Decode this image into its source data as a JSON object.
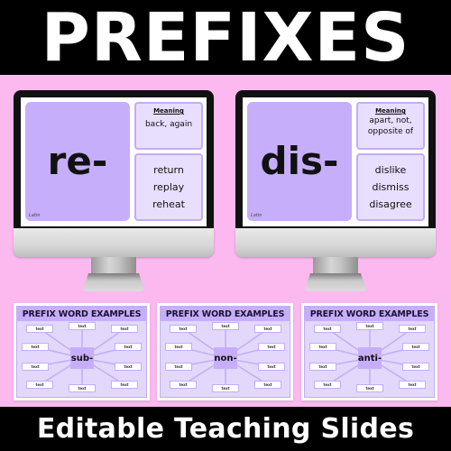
{
  "header": {
    "title": "PREFIXES"
  },
  "footer": {
    "subtitle": "Editable Teaching Slides"
  },
  "colors": {
    "background": "#fbb9ef",
    "banner": "#000000",
    "panel": "#c6aefb",
    "box": "#e8defd",
    "border": "#c3acf7"
  },
  "monitors": [
    {
      "prefix": "re-",
      "origin": "Latin",
      "meaning_label": "Meaning",
      "meaning": "back, again",
      "examples": [
        "return",
        "replay",
        "reheat"
      ]
    },
    {
      "prefix": "dis-",
      "origin": "Latin",
      "meaning_label": "Meaning",
      "meaning": "apart, not, opposite of",
      "examples": [
        "dislike",
        "dismiss",
        "disagree"
      ]
    }
  ],
  "slides": [
    {
      "title": "PREFIX WORD EXAMPLES",
      "prefix": "sub-",
      "boxes": [
        "text",
        "text",
        "text",
        "text",
        "text",
        "text",
        "text",
        "text",
        "text",
        "text"
      ]
    },
    {
      "title": "PREFIX WORD EXAMPLES",
      "prefix": "non-",
      "boxes": [
        "text",
        "text",
        "text",
        "text",
        "text",
        "text",
        "text",
        "text",
        "text",
        "text"
      ]
    },
    {
      "title": "PREFIX WORD EXAMPLES",
      "prefix": "anti-",
      "boxes": [
        "text",
        "text",
        "text",
        "text",
        "text",
        "text",
        "text",
        "text",
        "text",
        "text"
      ]
    }
  ]
}
